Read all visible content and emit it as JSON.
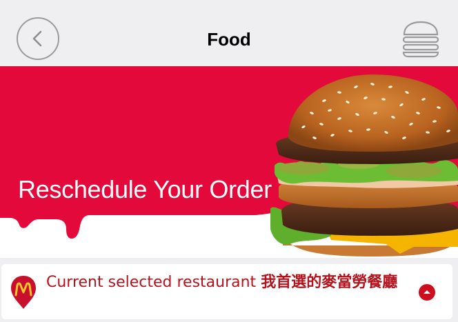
{
  "header": {
    "title": "Food",
    "back_icon": "chevron-left-icon",
    "menu_icon": "burger-menu-icon"
  },
  "banner": {
    "headline": "Reschedule Your Order",
    "background_color": "#e4093b",
    "image": "big-mac-burger-photo"
  },
  "restaurant": {
    "label": "Current selected restaurant",
    "name": "我首選的麥當勞餐廳",
    "pin_icon": "mcdonalds-location-pin-icon",
    "toggle_icon": "caret-up-icon",
    "accent_color": "#c8102e"
  },
  "colors": {
    "brand_red": "#e4093b",
    "text_red": "#b5121b",
    "header_bg": "#efeff2"
  }
}
